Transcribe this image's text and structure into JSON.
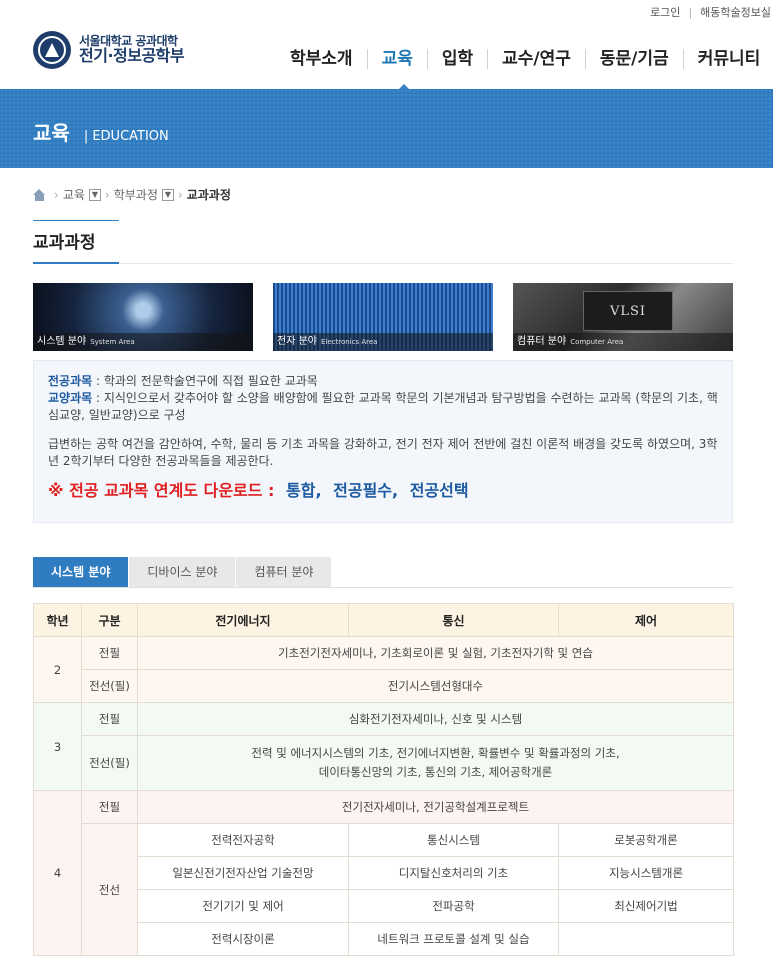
{
  "util": {
    "login": "로그인",
    "alumni": "해동학술정보실"
  },
  "logo": {
    "line1": "서울대학교 공과대학",
    "line2": "전기·정보공학부"
  },
  "nav": [
    "학부소개",
    "교육",
    "입학",
    "교수/연구",
    "동문/기금",
    "커뮤니티"
  ],
  "banner": {
    "title": "교육",
    "subtitle": "| EDUCATION"
  },
  "breadcrumb": {
    "level1": "교육",
    "level2": "학부과정",
    "current": "교과과정"
  },
  "page_title": "교과과정",
  "areas": [
    {
      "label": "시스템 분야",
      "en": "System Area"
    },
    {
      "label": "전자 분야",
      "en": "Electronics Area"
    },
    {
      "label": "컴퓨터 분야",
      "en": "Computer Area",
      "chip": "VLSI"
    }
  ],
  "info": {
    "major_key": "전공과목",
    "major_desc": " : 학과의 전문학술연구에 직접 필요한 교과목",
    "liberal_key": "교양과목",
    "liberal_desc": " : 지식인으로서 갖추어야 할 소양을 배양함에 필요한 교과목 학문의 기본개념과 탐구방법을 수련하는 교과목 (학문의 기초, 핵심교양, 일반교양)으로 구성",
    "paragraph": "급변하는 공학 여건을 감안하여, 수학, 물리 등 기초 과목을 강화하고, 전기 전자 제어 전반에 걸친 이론적 배경을 갖도록 하였으며, 3학년 2학기부터 다양한 전공과목들을 제공한다.",
    "download_label": "※ 전공 교과목 연계도 다운로드 :",
    "download_links": [
      "통합",
      "전공필수",
      "전공선택"
    ]
  },
  "tabs": [
    "시스템 분야",
    "디바이스 분야",
    "컴퓨터 분야"
  ],
  "table": {
    "headers": [
      "학년",
      "구분",
      "전기에너지",
      "통신",
      "제어"
    ],
    "y2": {
      "grade": "2",
      "r1_type": "전필",
      "r1_all": "기초전기전자세미나, 기초회로이론 및 실험, 기초전자기학 및 연습",
      "r2_type": "전선(필)",
      "r2_all": "전기시스템선형대수"
    },
    "y3": {
      "grade": "3",
      "r1_type": "전필",
      "r1_all": "심화전기전자세미나, 신호 및 시스템",
      "r2_type": "전선(필)",
      "r2_line1": "전력 및 에너지시스템의 기초, 전기에너지변환, 확률변수 및 확률과정의 기초,",
      "r2_line2": "데이타통신망의 기초, 통신의 기초, 제어공학개론"
    },
    "y4": {
      "grade": "4",
      "r1_type": "전필",
      "r1_all": "전기전자세미나, 전기공학설계프로젝트",
      "r2_type": "전선",
      "rows": [
        [
          "전력전자공학",
          "통신시스템",
          "로봇공학개론"
        ],
        [
          "일본신전기전자산업 기술전망",
          "디지탈신호처리의 기초",
          "지능시스템개론"
        ],
        [
          "전기기기 및 제어",
          "전파공학",
          "최신제어기법"
        ],
        [
          "전력시장이론",
          "네트워크 프로토콜 설계 및 실습",
          ""
        ]
      ]
    }
  },
  "colors": {
    "accent": "#2f7cc1",
    "nav_active": "#1e78b5",
    "download": "#e02020"
  }
}
